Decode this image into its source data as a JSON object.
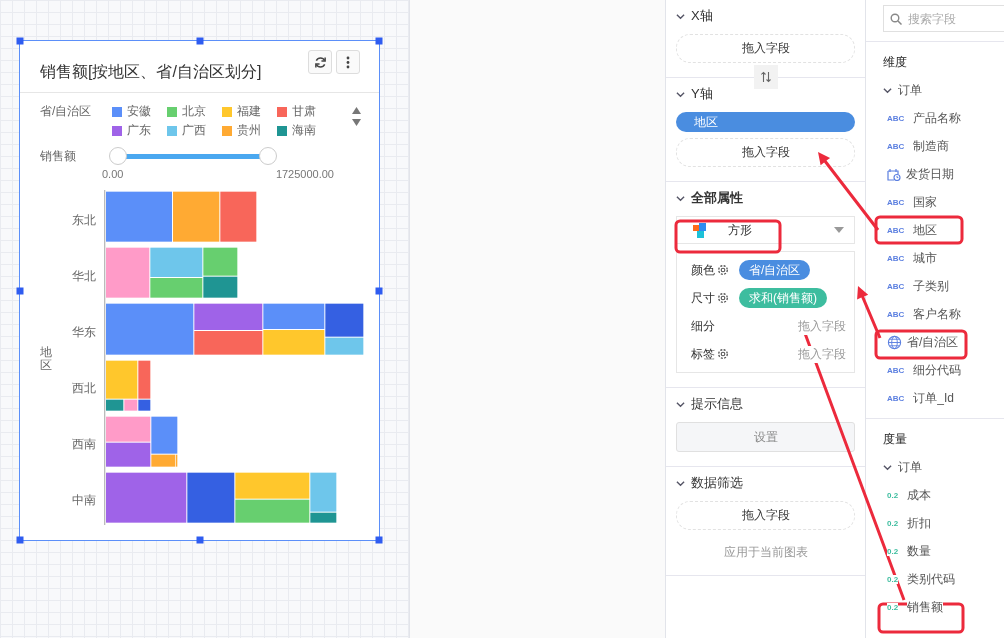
{
  "chart_card": {
    "title": "销售额[按地区、省/自治区划分]",
    "legend": {
      "label": "省/自治区",
      "items": [
        {
          "name": "安徽",
          "color": "#5b8ff9"
        },
        {
          "name": "北京",
          "color": "#67cf6f"
        },
        {
          "name": "福建",
          "color": "#ffc72c"
        },
        {
          "name": "甘肃",
          "color": "#f8665a"
        },
        {
          "name": "广东",
          "color": "#9f63e8"
        },
        {
          "name": "广西",
          "color": "#6ec6eb"
        },
        {
          "name": "贵州",
          "color": "#ffaa33"
        },
        {
          "name": "海南",
          "color": "#1f9593"
        }
      ]
    },
    "size_filter": {
      "label": "销售额",
      "min": "0.00",
      "max": "1725000.00",
      "level": 1
    },
    "y_axis_title": "地区",
    "categories": [
      "东北",
      "华北",
      "华东",
      "西北",
      "西南",
      "中南"
    ]
  },
  "config": {
    "sections": [
      {
        "kind": "axis",
        "title": "X轴",
        "expanded": true,
        "drop_hint": "拖入字段"
      },
      {
        "kind": "axis",
        "title": "Y轴",
        "expanded": true,
        "chips": [
          "地区"
        ],
        "drop_hint": "拖入字段"
      },
      {
        "kind": "marks",
        "title": "全部属性",
        "expanded": true,
        "shape": "方形",
        "properties": [
          {
            "label": "颜色",
            "settings": true,
            "chip": "省/自治区",
            "color": "#4a8de0"
          },
          {
            "label": "尺寸",
            "settings": true,
            "chip": "求和(销售额)",
            "color": "#3dbd9f"
          },
          {
            "label": "细分",
            "settings": false,
            "drop_hint": "拖入字段"
          },
          {
            "label": "标签",
            "settings": true,
            "drop_hint": "拖入字段"
          }
        ]
      },
      {
        "kind": "button",
        "title": "提示信息",
        "expanded": true,
        "button": "设置"
      },
      {
        "kind": "filter",
        "title": "数据筛选",
        "expanded": true,
        "drop_hint": "拖入字段",
        "note": "应用于当前图表"
      }
    ]
  },
  "fields": {
    "search": {
      "placeholder": "搜索字段"
    },
    "groups": [
      {
        "title": "维度",
        "tables": [
          {
            "name": "订单",
            "expanded": true,
            "fields": [
              {
                "name": "产品名称",
                "kind": "text",
                "type_label": "ABC"
              },
              {
                "name": "制造商",
                "kind": "text",
                "type_label": "ABC"
              },
              {
                "name": "发货日期",
                "kind": "date"
              },
              {
                "name": "国家",
                "kind": "text",
                "type_label": "ABC"
              },
              {
                "name": "地区",
                "kind": "text",
                "type_label": "ABC"
              },
              {
                "name": "城市",
                "kind": "text",
                "type_label": "ABC"
              },
              {
                "name": "子类别",
                "kind": "text",
                "type_label": "ABC"
              },
              {
                "name": "客户名称",
                "kind": "text",
                "type_label": "ABC"
              },
              {
                "name": "省/自治区",
                "kind": "geo"
              },
              {
                "name": "细分代码",
                "kind": "text",
                "type_label": "ABC"
              },
              {
                "name": "订单_Id",
                "kind": "text",
                "type_label": "ABC"
              }
            ]
          }
        ]
      },
      {
        "title": "度量",
        "tables": [
          {
            "name": "订单",
            "expanded": true,
            "fields": [
              {
                "name": "成本",
                "kind": "number",
                "type_label": "0.2"
              },
              {
                "name": "折扣",
                "kind": "number",
                "type_label": "0.2"
              },
              {
                "name": "数量",
                "kind": "number",
                "type_label": "0.2"
              },
              {
                "name": "类别代码",
                "kind": "number",
                "type_label": "0.2"
              },
              {
                "name": "销售额",
                "kind": "number",
                "type_label": "0.2"
              }
            ]
          }
        ]
      }
    ]
  }
}
